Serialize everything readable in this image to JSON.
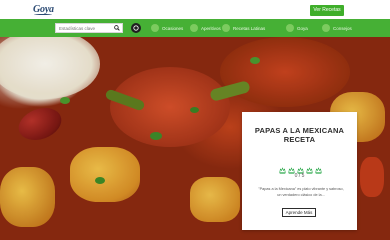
{
  "header": {
    "logo": "Goya",
    "cta_label": "Ver Recetas"
  },
  "nav": {
    "search": {
      "value": "",
      "placeholder": "Estadísticas clave"
    },
    "items": [
      {
        "label": "Ocasiones"
      },
      {
        "label": "Aperitivos"
      },
      {
        "label": "Recetas Latinas"
      },
      {
        "label": "Goya"
      },
      {
        "label": "Consejos"
      }
    ]
  },
  "recipe": {
    "title": "PAPAS A LA MEXICANA RECETA",
    "rating_text": "0 / 5",
    "stars": 0,
    "description": "\"Papas a la Mexicana\" es plato vibrante y sabroso, un verdadero clásico de la...",
    "more_label": "Aprende Más"
  },
  "colors": {
    "accent": "#46b035",
    "cta": "#3fae2a",
    "brand": "#2b4a73"
  }
}
